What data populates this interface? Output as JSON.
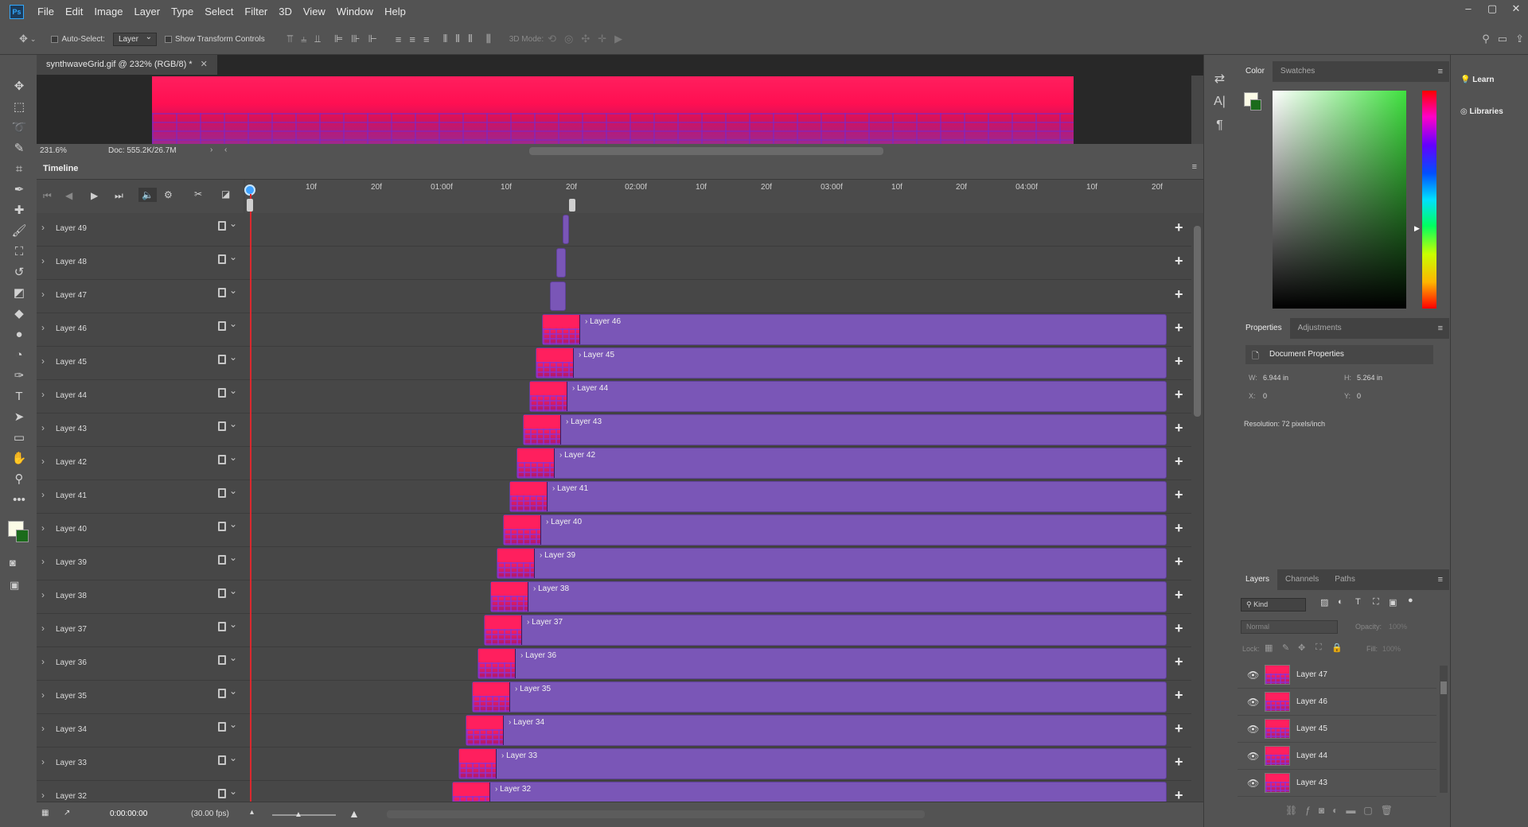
{
  "app_logo": "Ps",
  "menu": [
    "File",
    "Edit",
    "Image",
    "Layer",
    "Type",
    "Select",
    "Filter",
    "3D",
    "View",
    "Window",
    "Help"
  ],
  "window_controls": {
    "minimize": "–",
    "restore": "▢",
    "close": "✕"
  },
  "options": {
    "auto_select": "Auto-Select:",
    "auto_select_target": "Layer",
    "show_transform": "Show Transform Controls",
    "mode3d": "3D Mode:"
  },
  "document": {
    "tab": "synthwaveGrid.gif @ 232% (RGB/8) *",
    "zoom": "231.6%",
    "doc_info": "Doc: 555.2K/26.7M"
  },
  "timeline": {
    "title": "Timeline",
    "ticks": [
      "10f",
      "20f",
      "01:00f",
      "10f",
      "20f",
      "02:00f",
      "10f",
      "20f",
      "03:00f",
      "10f",
      "20f",
      "04:00f",
      "10f",
      "20f"
    ],
    "timecode": "0:00:00:00",
    "fps": "(30.00 fps)",
    "layers": [
      "Layer 49",
      "Layer 48",
      "Layer 47",
      "Layer 46",
      "Layer 45",
      "Layer 44",
      "Layer 43",
      "Layer 42",
      "Layer 41",
      "Layer 40",
      "Layer 39",
      "Layer 38",
      "Layer 37",
      "Layer 36",
      "Layer 35",
      "Layer 34",
      "Layer 33",
      "Layer 32"
    ]
  },
  "color_panel": {
    "tabs": [
      "Color",
      "Swatches"
    ]
  },
  "properties_panel": {
    "tabs": [
      "Properties",
      "Adjustments"
    ],
    "heading": "Document Properties",
    "w_label": "W:",
    "w_value": "6.944 in",
    "h_label": "H:",
    "h_value": "5.264 in",
    "x_label": "X:",
    "x_value": "0",
    "y_label": "Y:",
    "y_value": "0",
    "resolution": "Resolution: 72 pixels/inch"
  },
  "layers_panel": {
    "tabs": [
      "Layers",
      "Channels",
      "Paths"
    ],
    "filter": "Kind",
    "blend": "Normal",
    "opacity_label": "Opacity:",
    "opacity_value": "100%",
    "lock_label": "Lock:",
    "fill_label": "Fill:",
    "fill_value": "100%",
    "items": [
      "Layer 47",
      "Layer 46",
      "Layer 45",
      "Layer 44",
      "Layer 43"
    ]
  },
  "learn": {
    "learn": "Learn",
    "libraries": "Libraries"
  },
  "colors": {
    "clip": "#7a56b7",
    "playhead": "#d9292e",
    "canvas": "#ff0f52"
  }
}
